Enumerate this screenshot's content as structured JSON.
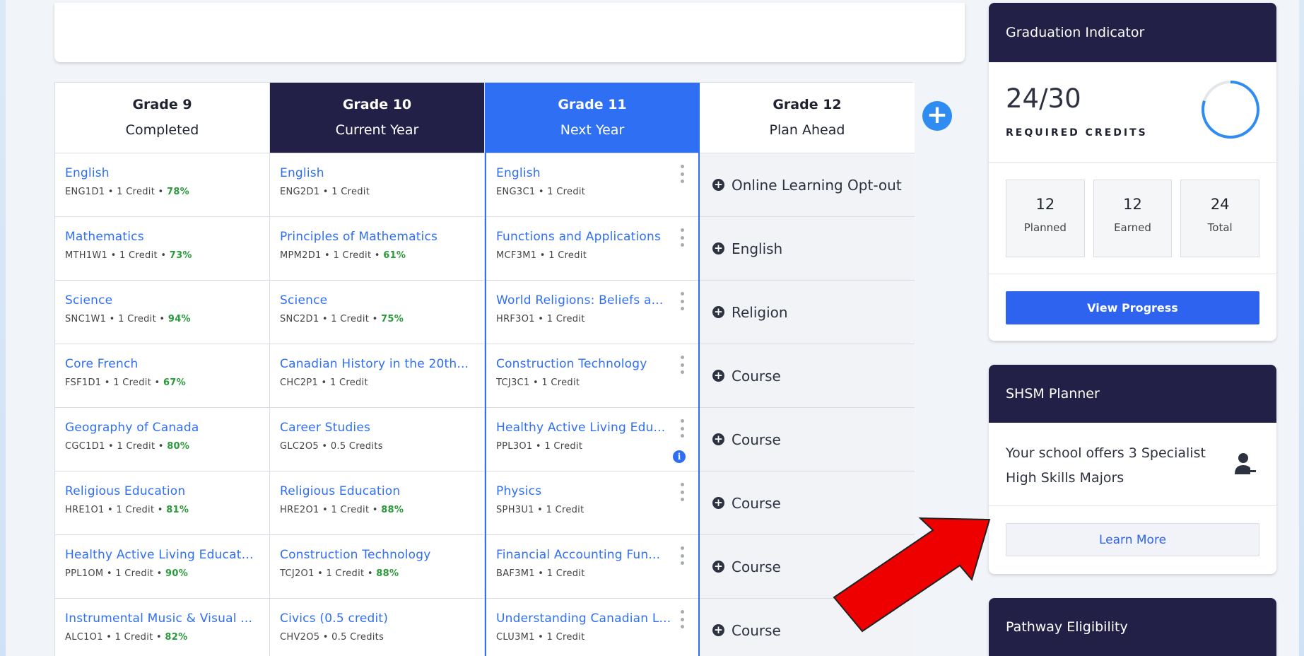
{
  "grades": [
    {
      "title": "Grade 9",
      "subtitle": "Completed",
      "courses": [
        {
          "name": "English",
          "code": "ENG1D1",
          "credit": "1 Credit",
          "grade": "78%"
        },
        {
          "name": "Mathematics",
          "code": "MTH1W1",
          "credit": "1 Credit",
          "grade": "73%"
        },
        {
          "name": "Science",
          "code": "SNC1W1",
          "credit": "1 Credit",
          "grade": "94%"
        },
        {
          "name": "Core French",
          "code": "FSF1D1",
          "credit": "1 Credit",
          "grade": "67%"
        },
        {
          "name": "Geography of Canada",
          "code": "CGC1D1",
          "credit": "1 Credit",
          "grade": "80%"
        },
        {
          "name": "Religious Education",
          "code": "HRE1O1",
          "credit": "1 Credit",
          "grade": "81%"
        },
        {
          "name": "Healthy Active Living Educati...",
          "code": "PPL1OM",
          "credit": "1 Credit",
          "grade": "90%"
        },
        {
          "name": "Instrumental Music & Visual ...",
          "code": "ALC1O1",
          "credit": "1 Credit",
          "grade": "82%"
        }
      ]
    },
    {
      "title": "Grade 10",
      "subtitle": "Current Year",
      "courses": [
        {
          "name": "English",
          "code": "ENG2D1",
          "credit": "1 Credit",
          "grade": ""
        },
        {
          "name": "Principles of Mathematics",
          "code": "MPM2D1",
          "credit": "1 Credit",
          "grade": "61%"
        },
        {
          "name": "Science",
          "code": "SNC2D1",
          "credit": "1 Credit",
          "grade": "75%"
        },
        {
          "name": "Canadian History in the 20th...",
          "code": "CHC2P1",
          "credit": "1 Credit",
          "grade": ""
        },
        {
          "name": "Career Studies",
          "code": "GLC2O5",
          "credit": "0.5 Credits",
          "grade": ""
        },
        {
          "name": "Religious Education",
          "code": "HRE2O1",
          "credit": "1 Credit",
          "grade": "88%"
        },
        {
          "name": "Construction Technology",
          "code": "TCJ2O1",
          "credit": "1 Credit",
          "grade": "88%"
        },
        {
          "name": "Civics (0.5 credit)",
          "code": "CHV2O5",
          "credit": "0.5 Credits",
          "grade": ""
        }
      ]
    },
    {
      "title": "Grade 11",
      "subtitle": "Next Year",
      "courses": [
        {
          "name": "English",
          "code": "ENG3C1",
          "credit": "1 Credit",
          "grade": ""
        },
        {
          "name": "Functions and Applications",
          "code": "MCF3M1",
          "credit": "1 Credit",
          "grade": ""
        },
        {
          "name": "World Religions: Beliefs a...",
          "code": "HRF3O1",
          "credit": "1 Credit",
          "grade": ""
        },
        {
          "name": "Construction Technology",
          "code": "TCJ3C1",
          "credit": "1 Credit",
          "grade": ""
        },
        {
          "name": "Healthy Active Living Edu...",
          "code": "PPL3O1",
          "credit": "1 Credit",
          "grade": ""
        },
        {
          "name": "Physics",
          "code": "SPH3U1",
          "credit": "1 Credit",
          "grade": ""
        },
        {
          "name": "Financial Accounting Fun...",
          "code": "BAF3M1",
          "credit": "1 Credit",
          "grade": ""
        },
        {
          "name": "Understanding Canadian L...",
          "code": "CLU3M1",
          "credit": "1 Credit",
          "grade": ""
        }
      ]
    },
    {
      "title": "Grade 12",
      "subtitle": "Plan Ahead",
      "plan_items": [
        "Online Learning Opt-out",
        "English",
        "Religion",
        "Course",
        "Course",
        "Course",
        "Course",
        "Course"
      ]
    }
  ],
  "graduation": {
    "title": "Graduation Indicator",
    "credits_text": "24/30",
    "credits_label": "REQUIRED CREDITS",
    "progress_fraction": 0.8,
    "stats": [
      {
        "value": "12",
        "label": "Planned"
      },
      {
        "value": "12",
        "label": "Earned"
      },
      {
        "value": "24",
        "label": "Total"
      }
    ],
    "button_label": "View Progress"
  },
  "shsm": {
    "title": "SHSM Planner",
    "text": "Your school offers 3 Specialist High Skills Majors",
    "button_label": "Learn More"
  },
  "pathway": {
    "title": "Pathway Eligibility"
  },
  "colors": {
    "navy": "#222047",
    "blue": "#2f6ff3",
    "green": "#2a9b3a",
    "arrow": "#ee0000"
  },
  "icons": {
    "add": "plus-circle",
    "menu": "kebab-vertical",
    "info": "info-circle",
    "person": "person-minus"
  }
}
